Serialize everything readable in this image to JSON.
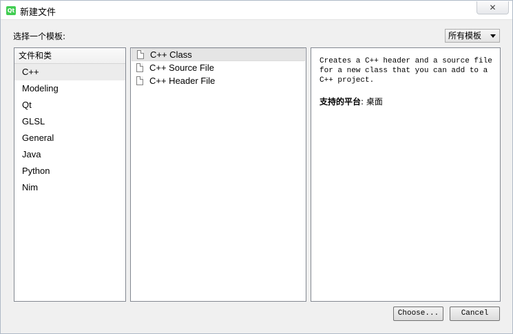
{
  "window": {
    "title": "新建文件",
    "app_icon_text": "Qt",
    "close_glyph": "✕"
  },
  "header": {
    "choose_template_label": "选择一个模板:",
    "filter": {
      "selected": "所有模板"
    }
  },
  "categories": {
    "group_label": "文件和类",
    "items": [
      {
        "label": "C++",
        "selected": true
      },
      {
        "label": "Modeling"
      },
      {
        "label": "Qt"
      },
      {
        "label": "GLSL"
      },
      {
        "label": "General"
      },
      {
        "label": "Java"
      },
      {
        "label": "Python"
      },
      {
        "label": "Nim"
      }
    ]
  },
  "templates": [
    {
      "label": "C++ Class",
      "icon": "file-icon",
      "selected": true
    },
    {
      "label": "C++ Source File",
      "icon": "file-icon"
    },
    {
      "label": "C++ Header File",
      "icon": "file-icon"
    }
  ],
  "description": {
    "text": "Creates a C++ header and a source file for a new class that you can add to a C++ project.",
    "platform_label": "支持的平台",
    "platform_value": ": 桌面"
  },
  "buttons": {
    "choose": "Choose...",
    "cancel": "Cancel"
  }
}
